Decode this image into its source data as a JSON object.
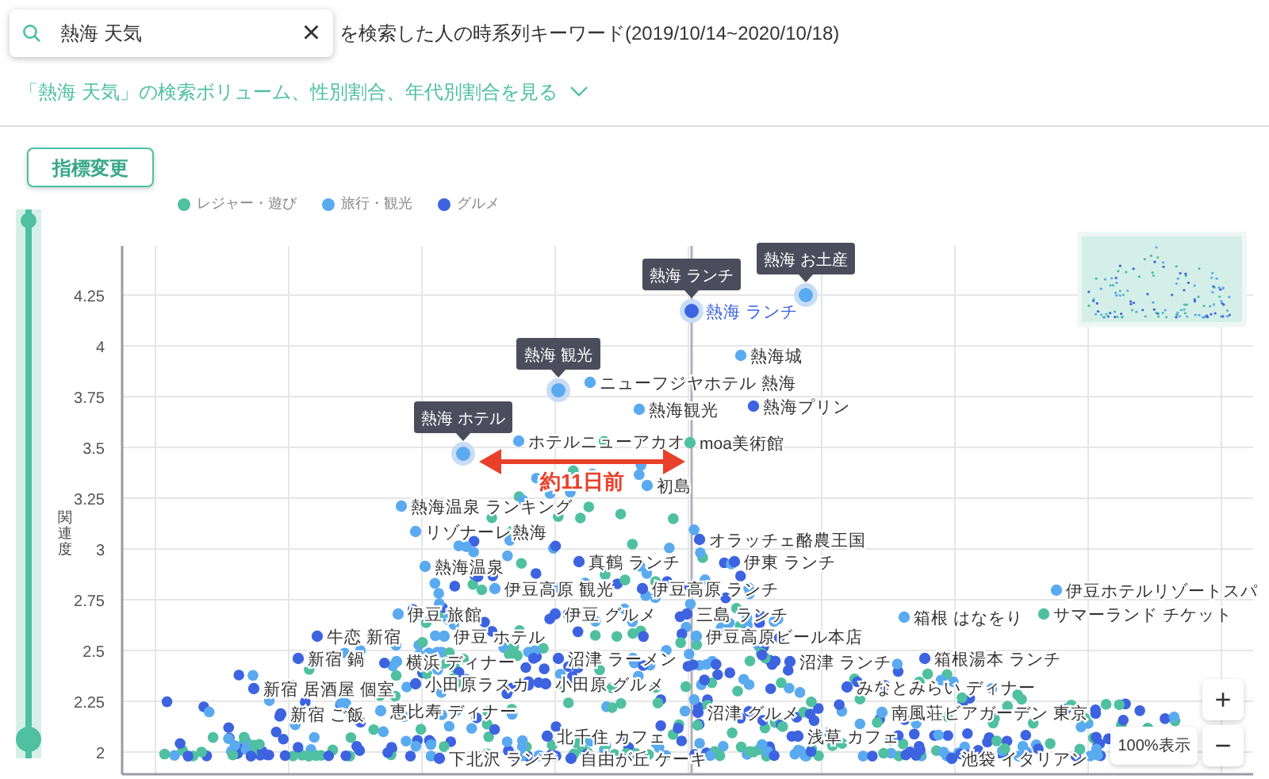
{
  "search": {
    "value": "熱海 天気",
    "clear": "×"
  },
  "heading": "を検索した人の時系列キーワード(2019/10/14~2020/10/18)",
  "volume_link": "「熱海 天気」の検索ボリューム、性別割合、年代別割合を見る",
  "metric_button": "指標変更",
  "range_slider": {
    "level": 1
  },
  "categories": [
    {
      "kind": "leisure",
      "name": "レジャー・遊び",
      "color": "#4fc0a0"
    },
    {
      "kind": "travel",
      "name": "旅行・観光",
      "color": "#5aaaf0"
    },
    {
      "kind": "gourmet",
      "name": "グルメ",
      "color": "#3d63e0"
    }
  ],
  "chart": {
    "y_axis_label": "関連度",
    "y_ticks": [
      "4.25",
      "4",
      "3.75",
      "3.5",
      "3.25",
      "3",
      "2.75",
      "2.5",
      "2.25",
      "2"
    ],
    "span_label": "約11日前",
    "keywords": [
      {
        "kind": "travel",
        "highlighted": true,
        "tooltip": "熱海 お土産"
      },
      {
        "label": "熱海 ランチ",
        "kind": "gourmet",
        "highlighted": true,
        "tooltip": "熱海 ランチ"
      },
      {
        "label": "熱海城",
        "kind": "travel",
        "highlighted": false
      },
      {
        "label": "ニューフジヤホテル 熱海",
        "kind": "travel",
        "highlighted": false
      },
      {
        "kind": "travel",
        "highlighted": true,
        "tooltip": "熱海 観光"
      },
      {
        "label": "熱海プリン",
        "kind": "gourmet",
        "highlighted": false
      },
      {
        "label": "熱海観光",
        "kind": "travel",
        "highlighted": false
      },
      {
        "label": "ホテルニューアカオ",
        "kind": "travel",
        "highlighted": false
      },
      {
        "label": "moa美術館",
        "kind": "leisure",
        "highlighted": false
      },
      {
        "kind": "travel",
        "highlighted": true,
        "tooltip": "熱海 ホテル"
      },
      {
        "label": "初島",
        "kind": "travel",
        "highlighted": false
      },
      {
        "label": "熱海温泉 ランキング",
        "kind": "travel",
        "highlighted": false
      },
      {
        "label": "リゾナーレ熱海",
        "kind": "travel",
        "highlighted": false
      },
      {
        "label": "オラッチェ酪農王国",
        "kind": "gourmet",
        "highlighted": false
      },
      {
        "label": "熱海温泉",
        "kind": "travel",
        "highlighted": false
      },
      {
        "label": "真鶴 ランチ",
        "kind": "gourmet",
        "highlighted": false
      },
      {
        "label": "伊東 ランチ",
        "kind": "gourmet",
        "highlighted": false
      },
      {
        "label": "伊豆高原 観光",
        "kind": "travel",
        "highlighted": false
      },
      {
        "label": "伊豆高原 ランチ",
        "kind": "gourmet",
        "highlighted": false
      },
      {
        "label": "伊豆ホテルリゾートスパ",
        "kind": "travel",
        "highlighted": false
      },
      {
        "label": "伊豆 旅館",
        "kind": "travel",
        "highlighted": false
      },
      {
        "label": "伊豆 グルメ",
        "kind": "gourmet",
        "highlighted": false
      },
      {
        "label": "三島 ランチ",
        "kind": "gourmet",
        "highlighted": false
      },
      {
        "label": "箱根 はなをり",
        "kind": "travel",
        "highlighted": false
      },
      {
        "label": "サマーランド チケット",
        "kind": "leisure",
        "highlighted": false
      },
      {
        "label": "牛恋 新宿",
        "kind": "gourmet",
        "highlighted": false
      },
      {
        "label": "伊豆 ホテル",
        "kind": "travel",
        "highlighted": false
      },
      {
        "label": "伊豆高原ビール本店",
        "kind": "travel",
        "highlighted": false
      },
      {
        "label": "新宿 鍋",
        "kind": "gourmet",
        "highlighted": false
      },
      {
        "label": "横浜 ディナー",
        "kind": "travel",
        "highlighted": false
      },
      {
        "label": "沼津 ラーメン",
        "kind": "gourmet",
        "highlighted": false
      },
      {
        "label": "沼津 ランチ",
        "kind": "gourmet",
        "highlighted": false
      },
      {
        "label": "箱根湯本 ランチ",
        "kind": "gourmet",
        "highlighted": false
      },
      {
        "label": "新宿 居酒屋 個室",
        "kind": "gourmet",
        "highlighted": false
      },
      {
        "label": "小田原ラスカ",
        "kind": "gourmet",
        "highlighted": false
      },
      {
        "label": "小田原 グルメ",
        "kind": "gourmet",
        "highlighted": false
      },
      {
        "label": "みなとみらい ディナー",
        "kind": "gourmet",
        "highlighted": false
      },
      {
        "label": "新宿 ご飯",
        "kind": "gourmet",
        "highlighted": false
      },
      {
        "label": "恵比寿 ディナー",
        "kind": "travel",
        "highlighted": false
      },
      {
        "label": "沼津 グルメ",
        "kind": "gourmet",
        "highlighted": false
      },
      {
        "label": "南風荘ビアガーデン 東京",
        "kind": "travel",
        "highlighted": false
      },
      {
        "label": "北千住 カフェ",
        "kind": "gourmet",
        "highlighted": false
      },
      {
        "label": "浅草 カフェ",
        "kind": "gourmet",
        "highlighted": false
      },
      {
        "label": "下北沢 ランチ",
        "kind": "gourmet",
        "highlighted": false
      },
      {
        "label": "自由が丘 ケーキ",
        "kind": "gourmet",
        "highlighted": false
      },
      {
        "label": "池袋 イタリアン",
        "kind": "gourmet",
        "highlighted": false
      }
    ]
  },
  "zoom": {
    "in": "+",
    "reset": "100%表示",
    "out": "−"
  }
}
